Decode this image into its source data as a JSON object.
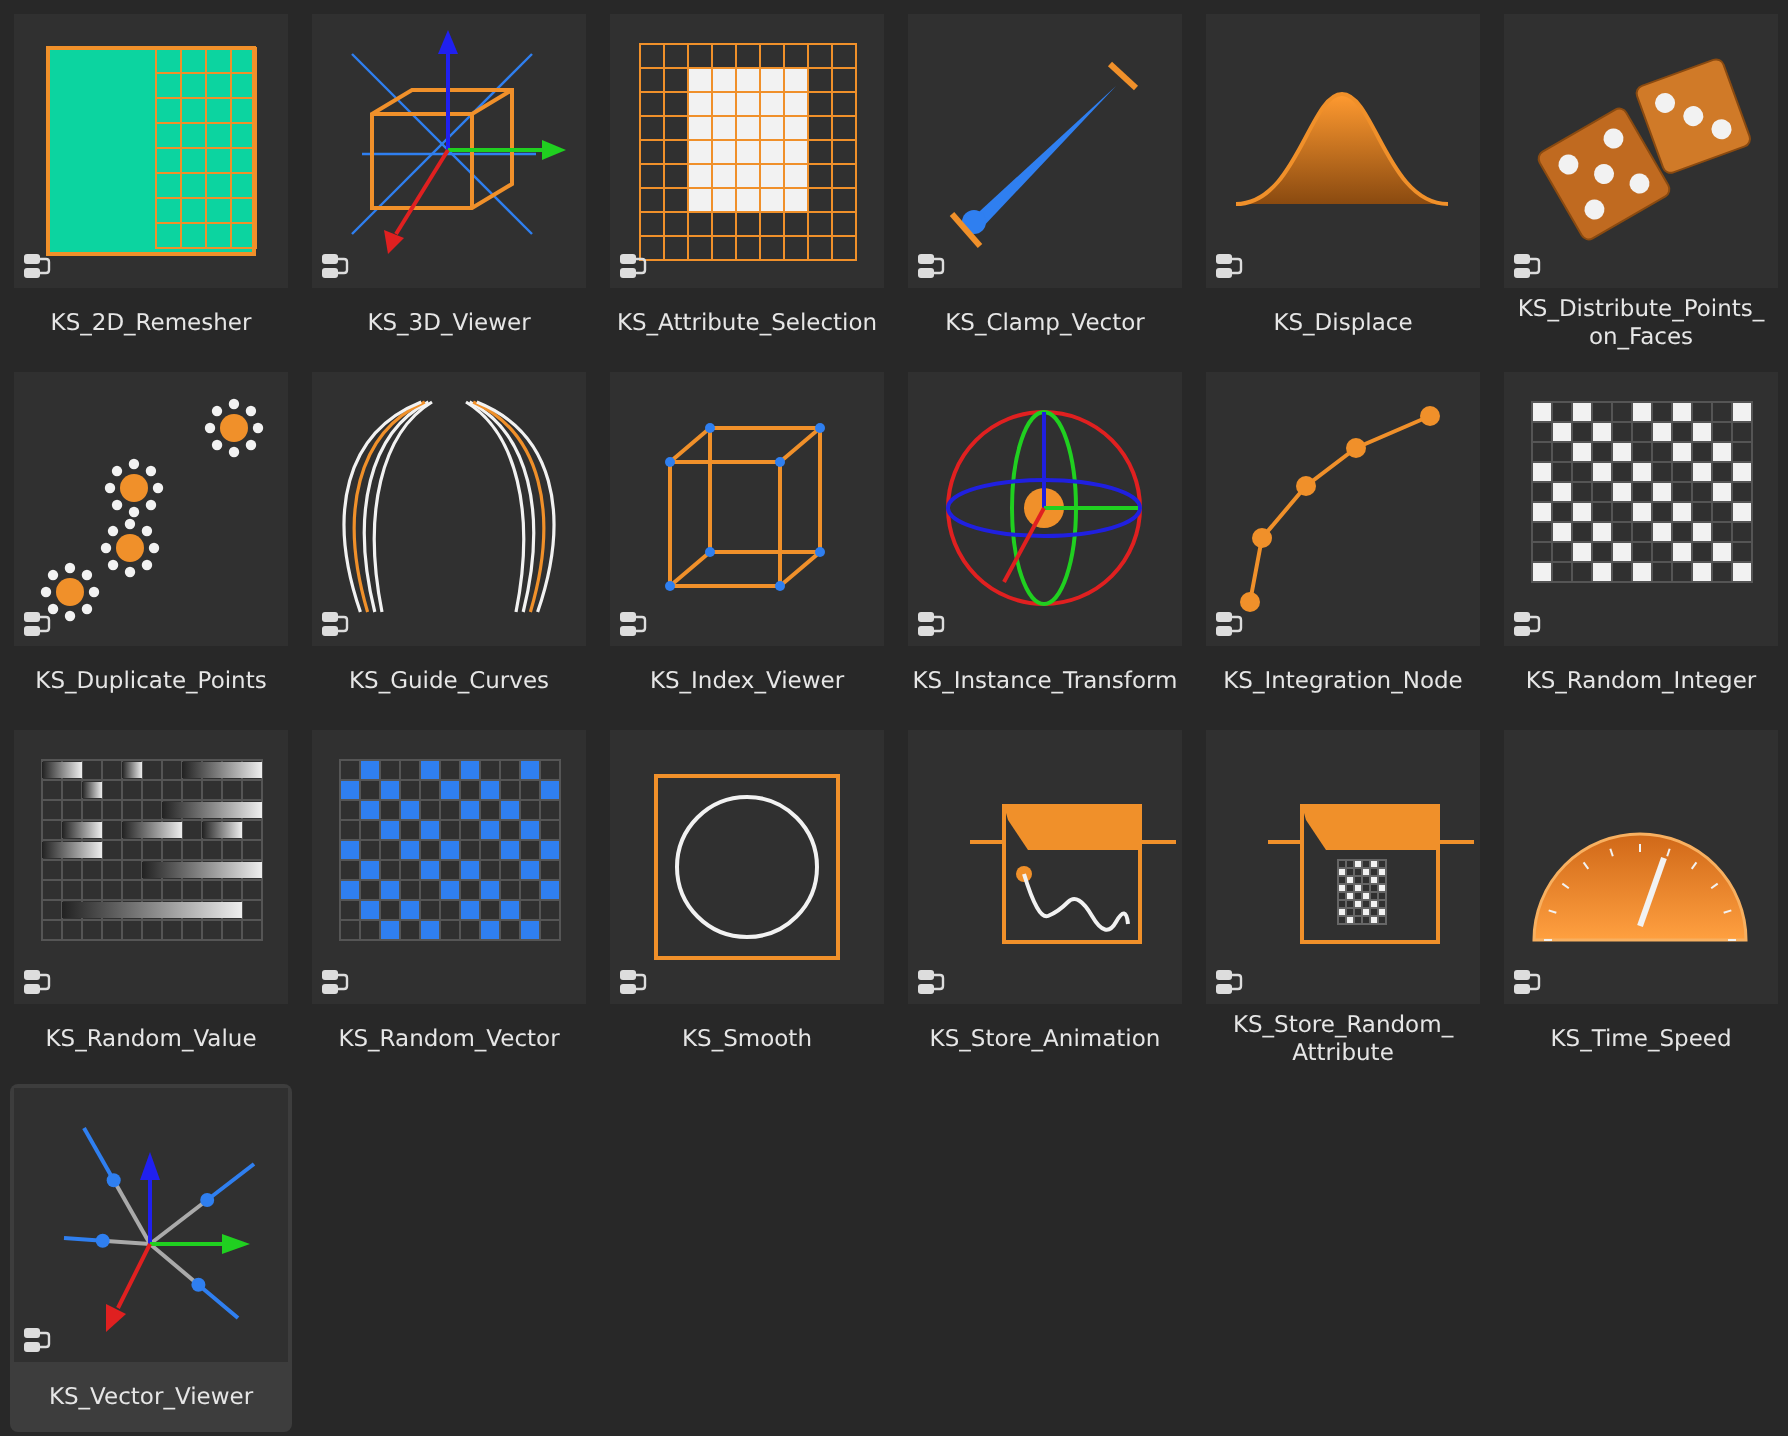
{
  "assets": [
    {
      "name": "KS_2D_Remesher",
      "kind": "remesher",
      "selected": false
    },
    {
      "name": "KS_3D_Viewer",
      "kind": "viewer3d",
      "selected": false
    },
    {
      "name": "KS_Attribute_Selection",
      "kind": "selection",
      "selected": false
    },
    {
      "name": "KS_Clamp_Vector",
      "kind": "clamp",
      "selected": false
    },
    {
      "name": "KS_Displace",
      "kind": "displace",
      "selected": false
    },
    {
      "name": "KS_Distribute_Points_on_Faces",
      "kind": "dice",
      "selected": false
    },
    {
      "name": "KS_Duplicate_Points",
      "kind": "duplicate",
      "selected": false
    },
    {
      "name": "KS_Guide_Curves",
      "kind": "curves",
      "selected": false
    },
    {
      "name": "KS_Index_Viewer",
      "kind": "cube",
      "selected": false
    },
    {
      "name": "KS_Instance_Transform",
      "kind": "gizmo",
      "selected": false
    },
    {
      "name": "KS_Integration_Node",
      "kind": "integration",
      "selected": false
    },
    {
      "name": "KS_Random_Integer",
      "kind": "randint",
      "selected": false
    },
    {
      "name": "KS_Random_Value",
      "kind": "randvalue",
      "selected": false
    },
    {
      "name": "KS_Random_Vector",
      "kind": "randvector",
      "selected": false
    },
    {
      "name": "KS_Smooth",
      "kind": "smooth",
      "selected": false
    },
    {
      "name": "KS_Store_Animation",
      "kind": "storeanim",
      "selected": false
    },
    {
      "name": "KS_Store_Random_Attribute",
      "kind": "storerandom",
      "selected": false
    },
    {
      "name": "KS_Time_Speed",
      "kind": "gauge",
      "selected": false
    },
    {
      "name": "KS_Vector_Viewer",
      "kind": "vectors",
      "selected": true
    }
  ]
}
